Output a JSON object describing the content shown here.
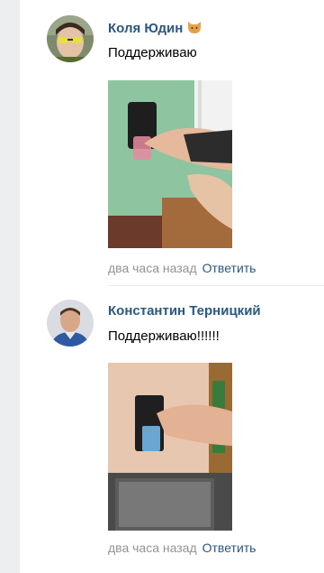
{
  "comments": [
    {
      "author": "Коля Юдин",
      "author_emoji_icon": "cat-emoji-icon",
      "text": "Поддерживаю",
      "time": "два часа назад",
      "reply_label": "Ответить"
    },
    {
      "author": "Константин Терницкий",
      "text": "Поддерживаю!!!!!!",
      "time": "два часа назад",
      "reply_label": "Ответить"
    }
  ],
  "colors": {
    "link": "#2a5885",
    "meta": "#939393",
    "background": "#edeef0"
  }
}
